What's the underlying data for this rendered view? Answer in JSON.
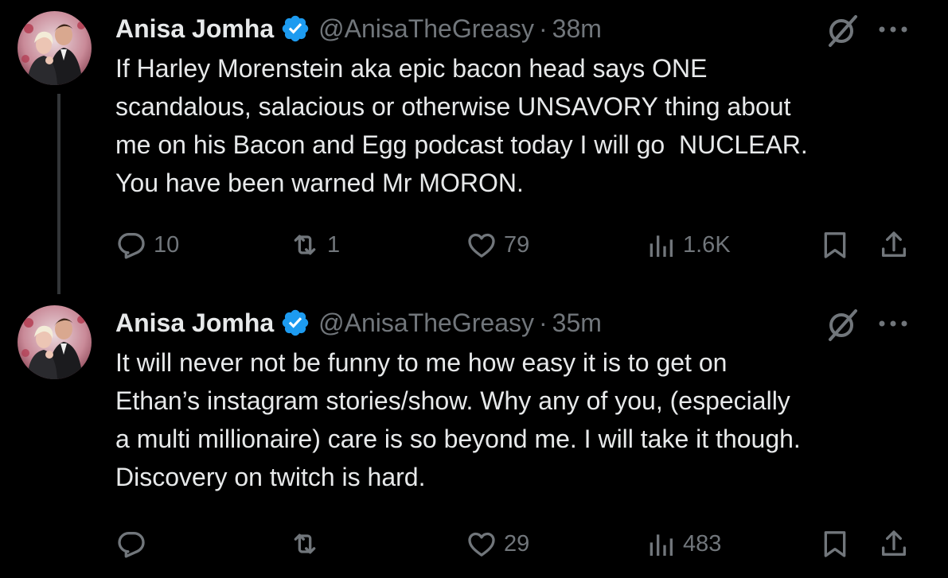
{
  "colors": {
    "background": "#000000",
    "text": "#e7e9ea",
    "muted": "#71767b",
    "verified": "#1d9bf0",
    "thread_line": "#333639"
  },
  "tweets": [
    {
      "author": {
        "display_name": "Anisa Jomha",
        "handle": "@AnisaTheGreasy",
        "verified": true
      },
      "separator": "·",
      "timestamp": "38m",
      "text": "If Harley Morenstein aka epic bacon head says ONE\nscandalous, salacious or otherwise UNSAVORY thing about\nme on his Bacon and Egg podcast today I will go  NUCLEAR.\nYou have been warned Mr MORON.",
      "stats": {
        "replies": "10",
        "reposts": "1",
        "likes": "79",
        "views": "1.6K"
      },
      "icons": [
        "grok-icon",
        "more-icon",
        "reply-icon",
        "repost-icon",
        "like-icon",
        "views-icon",
        "bookmark-icon",
        "share-icon"
      ]
    },
    {
      "author": {
        "display_name": "Anisa Jomha",
        "handle": "@AnisaTheGreasy",
        "verified": true
      },
      "separator": "·",
      "timestamp": "35m",
      "text": "It will never not be funny to me how easy it is to get on\nEthan’s instagram stories/show. Why any of you, (especially\na multi millionaire) care is so beyond me. I will take it though.\nDiscovery on twitch is hard.",
      "stats": {
        "replies": "",
        "reposts": "",
        "likes": "29",
        "views": "483"
      },
      "icons": [
        "grok-icon",
        "more-icon",
        "reply-icon",
        "repost-icon",
        "like-icon",
        "views-icon",
        "bookmark-icon",
        "share-icon"
      ]
    }
  ]
}
